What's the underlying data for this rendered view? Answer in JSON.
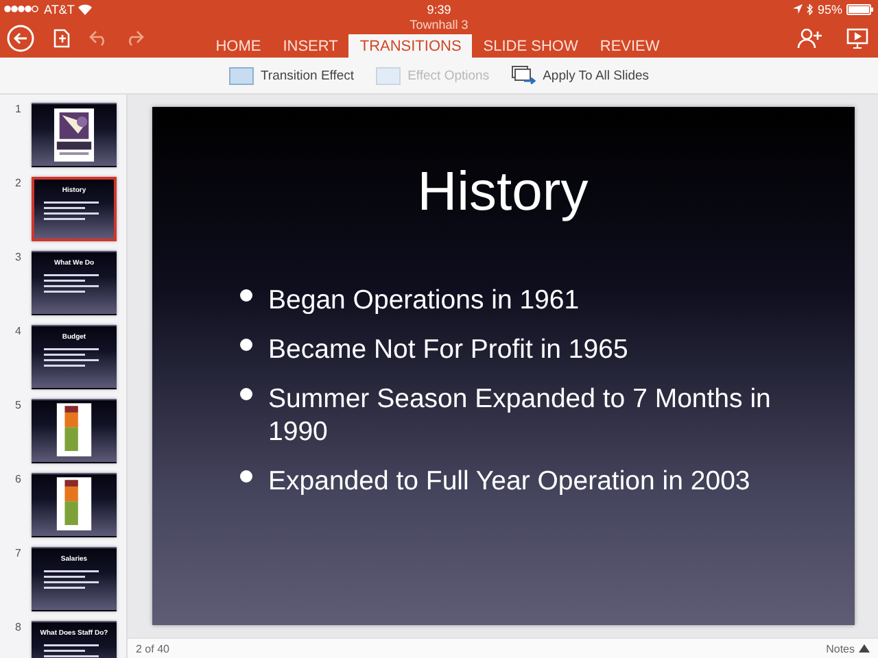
{
  "status_bar": {
    "carrier": "AT&T",
    "time": "9:39",
    "battery": "95%"
  },
  "window": {
    "title": "Townhall 3"
  },
  "tabs": [
    {
      "label": "HOME",
      "selected": false
    },
    {
      "label": "INSERT",
      "selected": false
    },
    {
      "label": "TRANSITIONS",
      "selected": true
    },
    {
      "label": "SLIDE SHOW",
      "selected": false
    },
    {
      "label": "REVIEW",
      "selected": false
    }
  ],
  "ribbon": [
    {
      "label": "Transition Effect",
      "disabled": false,
      "kind": "effect"
    },
    {
      "label": "Effect Options",
      "disabled": true,
      "kind": "effect"
    },
    {
      "label": "Apply To All Slides",
      "disabled": false,
      "kind": "apply"
    }
  ],
  "thumbnails": [
    {
      "number": "1",
      "kind": "logo",
      "selected": false
    },
    {
      "number": "2",
      "kind": "text",
      "title": "History",
      "selected": true
    },
    {
      "number": "3",
      "kind": "text",
      "title": "What We Do",
      "selected": false
    },
    {
      "number": "4",
      "kind": "text",
      "title": "Budget",
      "selected": false
    },
    {
      "number": "5",
      "kind": "chart",
      "selected": false
    },
    {
      "number": "6",
      "kind": "chart",
      "selected": false
    },
    {
      "number": "7",
      "kind": "text",
      "title": "Salaries",
      "selected": false
    },
    {
      "number": "8",
      "kind": "text",
      "title": "What Does Staff Do?",
      "selected": false
    }
  ],
  "slide": {
    "title": "History",
    "bullets": [
      "Began Operations in 1961",
      "Became Not For Profit in 1965",
      "Summer Season Expanded to 7 Months in 1990",
      "Expanded to Full Year Operation in 2003"
    ]
  },
  "footer": {
    "position": "2 of 40",
    "notes": "Notes"
  }
}
